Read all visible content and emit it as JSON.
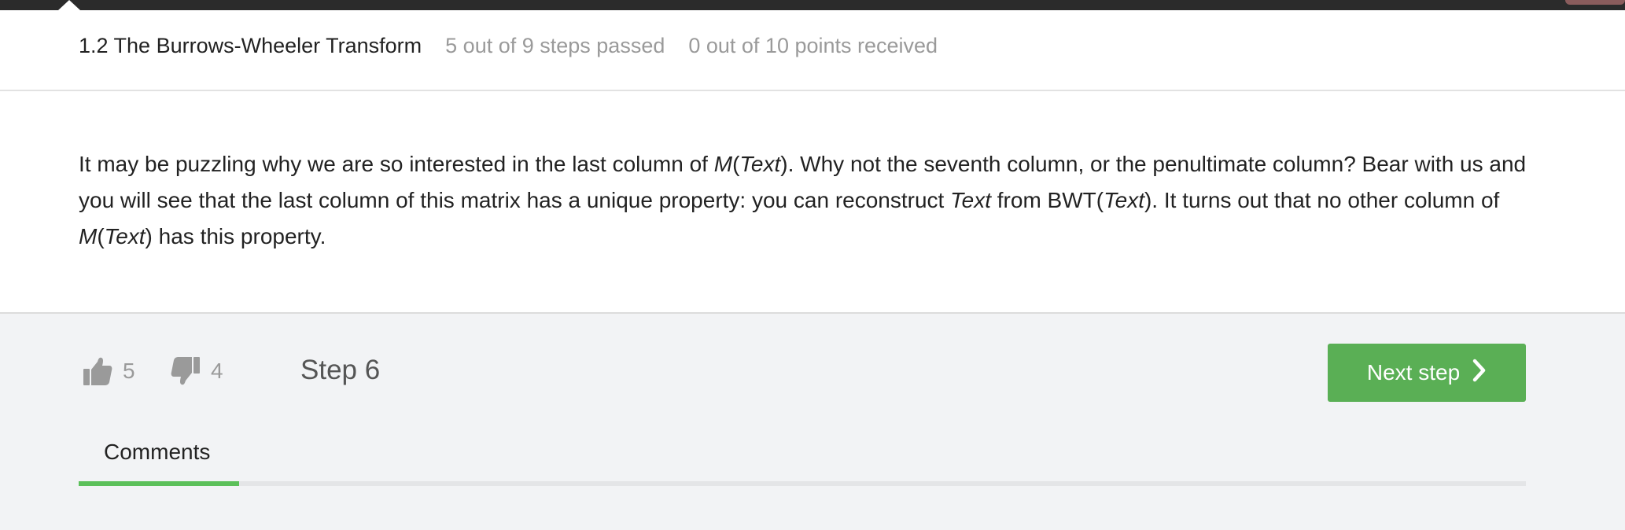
{
  "header": {
    "lesson_title": "1.2 The Burrows-Wheeler Transform",
    "steps_passed": "5 out of 9 steps passed",
    "points_received": "0 out of 10 points  received"
  },
  "content": {
    "paragraph": [
      {
        "t": "It may be puzzling why we are so interested in the last column of "
      },
      {
        "t": "M",
        "i": true
      },
      {
        "t": "("
      },
      {
        "t": "Text",
        "i": true
      },
      {
        "t": "). Why not the seventh column, or the penultimate column? Bear with us and you will see that the last column of this matrix has a unique property: you can reconstruct "
      },
      {
        "t": "Text",
        "i": true
      },
      {
        "t": " from BWT("
      },
      {
        "t": "Text",
        "i": true
      },
      {
        "t": "). It turns out that no other column of "
      },
      {
        "t": "M",
        "i": true
      },
      {
        "t": "("
      },
      {
        "t": "Text",
        "i": true
      },
      {
        "t": ") has this property."
      }
    ]
  },
  "footer": {
    "likes": "5",
    "dislikes": "4",
    "step_label": "Step 6",
    "next_button": "Next step",
    "tabs": [
      {
        "label": "Comments",
        "active": true
      }
    ]
  },
  "icons": {
    "like": "thumbs-up-icon",
    "dislike": "thumbs-down-icon",
    "next": "chevron-right-icon"
  },
  "colors": {
    "topbar": "#2b2b2b",
    "accent_green": "#5aaf55",
    "tab_indicator": "#5cc05a",
    "muted_text": "#9a9a9a",
    "footer_bg": "#f2f3f5"
  }
}
